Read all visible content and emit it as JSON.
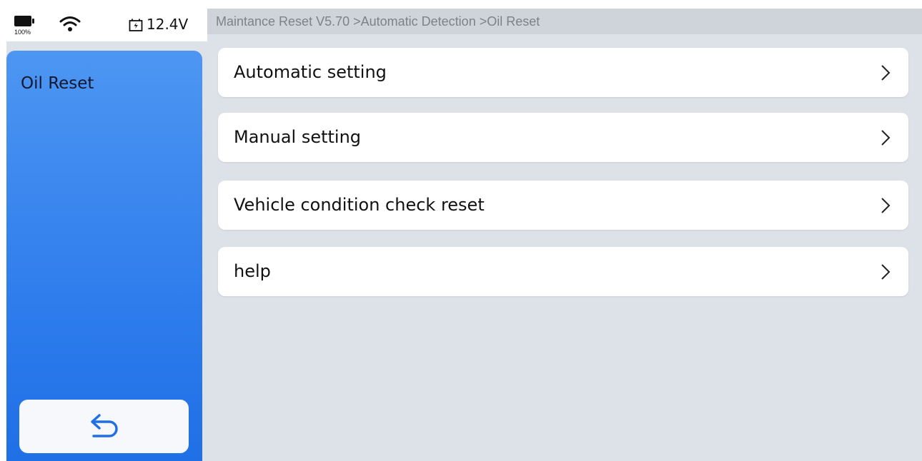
{
  "status": {
    "battery_percent": "100%",
    "battery_level": 1.0,
    "voltage": "12.4V"
  },
  "breadcrumb": "Maintance Reset V5.70 >Automatic Detection >Oil Reset",
  "sidebar": {
    "title": "Oil Reset",
    "back_icon": "back-arrow-icon"
  },
  "menu": {
    "items": [
      {
        "label": "Automatic setting",
        "icon": "chevron-right-icon"
      },
      {
        "label": "Manual setting",
        "icon": "chevron-right-icon"
      },
      {
        "label": "Vehicle condition check reset",
        "icon": "chevron-right-icon"
      },
      {
        "label": "help",
        "icon": "chevron-right-icon"
      }
    ]
  },
  "colors": {
    "accent_blue": "#2f7ded",
    "background": "#dde1e8",
    "breadcrumb_bg": "#cfd3da"
  }
}
